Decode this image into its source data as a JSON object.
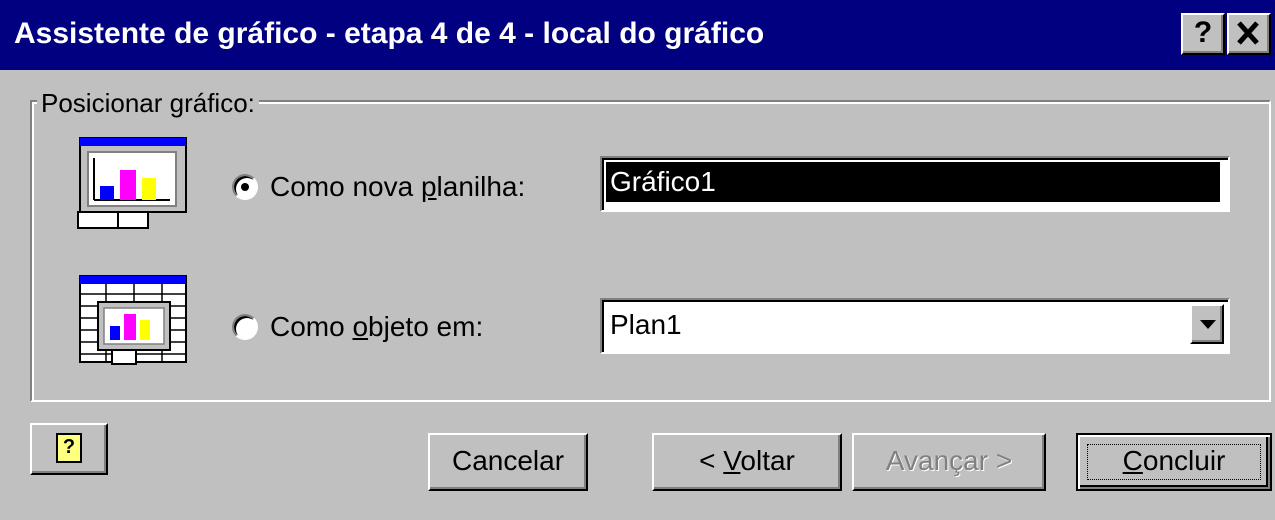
{
  "dialog": {
    "title": "Assistente de gráfico - etapa 4 de 4 - local do gráfico",
    "help_title_button": "?",
    "close_button": "✕"
  },
  "group": {
    "legend": "Posicionar gráfico:"
  },
  "options": {
    "new_sheet": {
      "label_before": "Como nova ",
      "label_mnemonic": "p",
      "label_after": "lanilha:",
      "value": "Gráfico1",
      "selected": true
    },
    "as_object": {
      "label_before": "Como ",
      "label_mnemonic": "o",
      "label_after": "bjeto em:",
      "value": "Plan1",
      "selected": false
    }
  },
  "buttons": {
    "cancel": "Cancelar",
    "back_before": "< ",
    "back_mnemonic": "V",
    "back_after": "oltar",
    "next": "Avançar >",
    "finish_mnemonic": "C",
    "finish_after": "oncluir"
  },
  "colors": {
    "titlebar": "#000080",
    "face": "#c0c0c0",
    "bar_blue": "#0000ff",
    "bar_magenta": "#ff00ff",
    "bar_yellow": "#ffff00"
  },
  "icons": {
    "new_sheet": "chart-sheet-icon",
    "embedded": "embedded-chart-icon",
    "help": "office-assistant-help-icon"
  }
}
